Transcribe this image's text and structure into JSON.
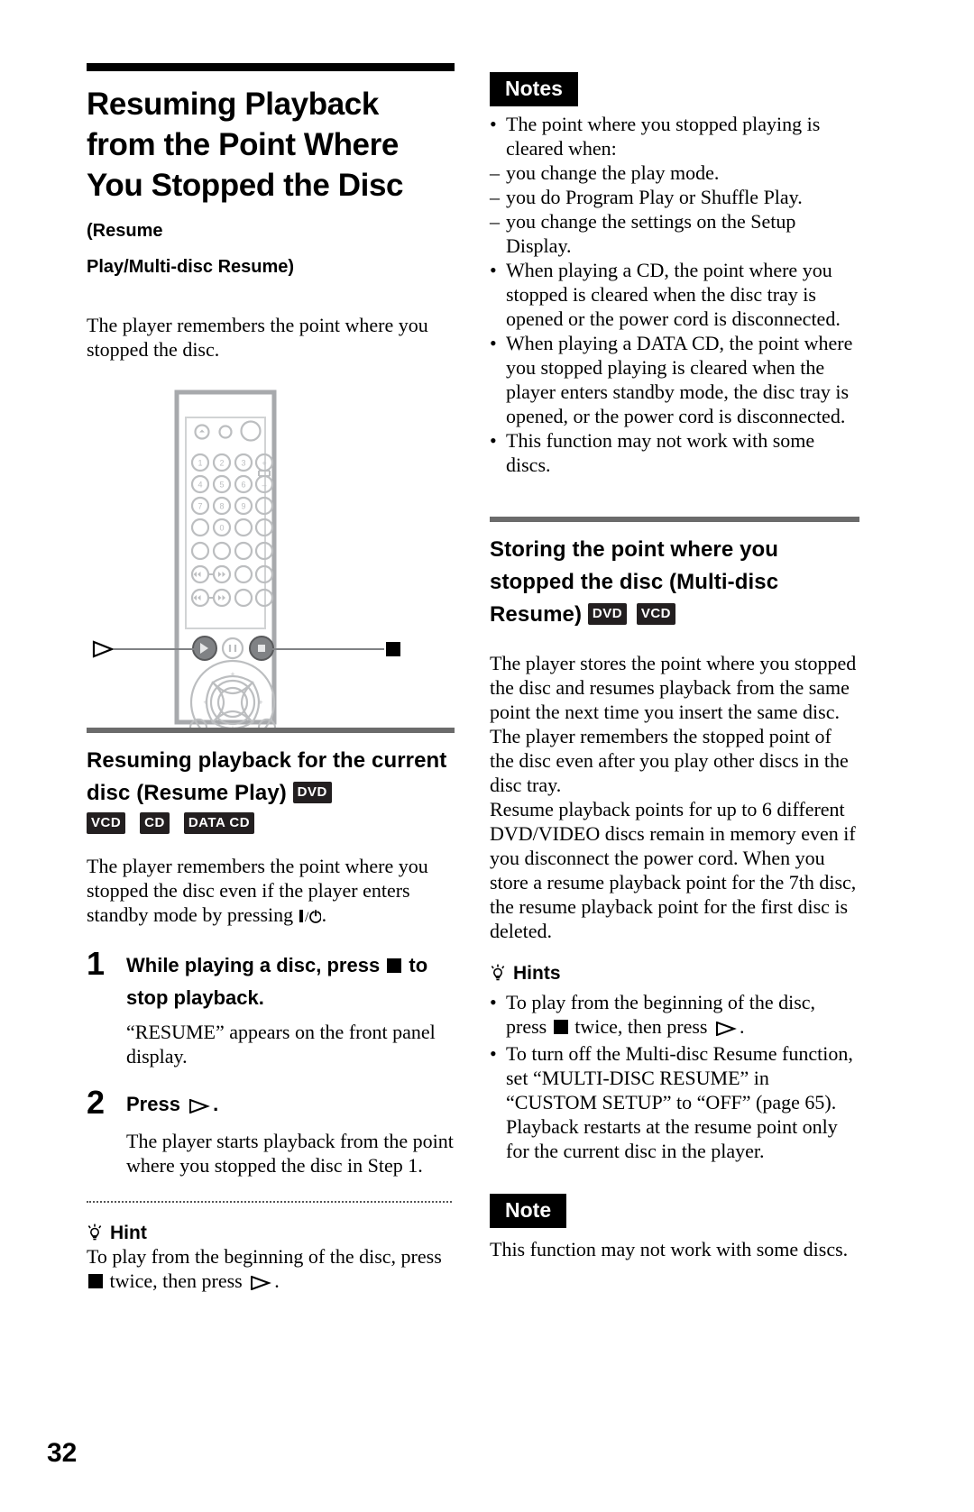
{
  "page": {
    "number": "32"
  },
  "left_column": {
    "title_main": "Resuming Playback from the Point Where You Stopped the Disc",
    "title_suffix": "(Resume",
    "title_continued": "Play/Multi-disc Resume)",
    "intro": "The player remembers the point where you stopped the disc.",
    "remote_diagram": {
      "left_callout": "play-button-callout",
      "right_callout": "stop-button-callout",
      "keypad_digits": [
        "1",
        "2",
        "3",
        "4",
        "5",
        "6",
        "7",
        "8",
        "9",
        "0"
      ],
      "volume_plus": "+",
      "volume_minus": "−"
    },
    "section2": {
      "heading": "Resuming playback for the current disc (Resume Play)",
      "badges_inline": [
        "DVD"
      ],
      "badges_row": [
        "VCD",
        "CD",
        "DATA CD"
      ],
      "intro_part1": "The player remembers the point where you stopped the disc even if the player enters standby mode by pressing ",
      "intro_part2": ".",
      "steps": [
        {
          "number": "1",
          "instruction_part1": "While playing a disc, press ",
          "instruction_part2": " to stop playback.",
          "detail": "“RESUME” appears on the front panel display."
        },
        {
          "number": "2",
          "instruction_part1": "Press ",
          "instruction_part2": ".",
          "detail": "The player starts playback from the point where you stopped the disc in Step 1."
        }
      ],
      "hint": {
        "label": "Hint",
        "text_part1": "To play from the beginning of the disc, press ",
        "text_part2": " twice, then press ",
        "text_part3": "."
      }
    }
  },
  "right_column": {
    "notes_box": {
      "label": "Notes",
      "items": [
        {
          "marker": "•",
          "text": "The point where you stopped playing is cleared when:"
        },
        {
          "marker": "–",
          "text": "you change the play mode."
        },
        {
          "marker": "–",
          "text": "you do Program Play or Shuffle Play."
        },
        {
          "marker": "–",
          "text": "you change the settings on the Setup Display."
        },
        {
          "marker": "•",
          "text": "When playing a CD, the point where you stopped is cleared when the disc tray is opened or the power cord is disconnected."
        },
        {
          "marker": "•",
          "text": "When playing a DATA CD, the point where you stopped playing is cleared when the player enters standby mode, the disc tray is opened, or the power cord is disconnected."
        },
        {
          "marker": "•",
          "text": "This function may not work with some discs."
        }
      ]
    },
    "section": {
      "heading": "Storing the point where you stopped the disc (Multi-disc Resume)",
      "badges": [
        "DVD",
        "VCD"
      ],
      "paragraphs": [
        "The player stores the point where you stopped the disc and resumes playback from the same point the next time you insert the same disc. The player remembers the stopped point of the disc even after you play other discs in the disc tray.",
        "Resume playback points for up to 6 different DVD/VIDEO discs remain in memory even if you disconnect the power cord. When you store a resume playback point for the 7th disc, the resume playback point for the first disc is deleted."
      ]
    },
    "hints_box": {
      "label": "Hints",
      "items": [
        {
          "part1": "To play from the beginning of the disc, press ",
          "glyph1": "stop",
          "part2": " twice, then press ",
          "glyph2": "play",
          "part3": "."
        },
        {
          "part1": "To turn off the Multi-disc Resume function, set “MULTI-DISC RESUME” in “CUSTOM SETUP” to “OFF” (page 65). Playback restarts at the resume point only for the current disc in the player.",
          "glyph1": "",
          "part2": "",
          "glyph2": "",
          "part3": ""
        }
      ]
    },
    "note_box": {
      "label": "Note",
      "text": "This function may not work with some discs."
    }
  }
}
